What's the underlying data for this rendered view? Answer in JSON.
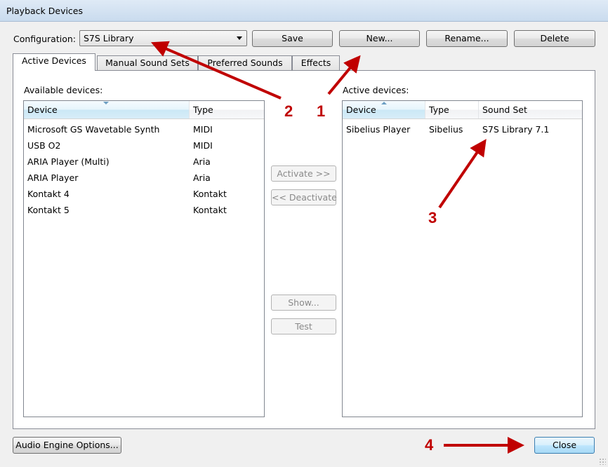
{
  "window": {
    "title": "Playback Devices"
  },
  "config": {
    "label": "Configuration:",
    "selected": "S7S Library",
    "save": "Save",
    "new": "New...",
    "rename": "Rename...",
    "delete": "Delete"
  },
  "tabs": [
    "Active Devices",
    "Manual Sound Sets",
    "Preferred Sounds",
    "Effects"
  ],
  "available": {
    "label": "Available devices:",
    "columns": [
      "Device",
      "Type"
    ],
    "rows": [
      [
        "Microsoft GS Wavetable Synth",
        "MIDI"
      ],
      [
        "USB O2",
        "MIDI"
      ],
      [
        "ARIA Player (Multi)",
        "Aria"
      ],
      [
        "ARIA Player",
        "Aria"
      ],
      [
        "Kontakt 4",
        "Kontakt"
      ],
      [
        "Kontakt 5",
        "Kontakt"
      ]
    ]
  },
  "middle": {
    "activate": "Activate >>",
    "deactivate": "<< Deactivate",
    "show": "Show...",
    "test": "Test"
  },
  "active": {
    "label": "Active devices:",
    "columns": [
      "Device",
      "Type",
      "Sound Set"
    ],
    "rows": [
      [
        "Sibelius Player",
        "Sibelius",
        "S7S Library 7.1"
      ]
    ]
  },
  "footer": {
    "audio_engine": "Audio Engine Options...",
    "close": "Close"
  },
  "annotations": [
    "1",
    "2",
    "3",
    "4"
  ],
  "colors": {
    "arrow": "#c00000",
    "accent": "#3c7fb1"
  }
}
